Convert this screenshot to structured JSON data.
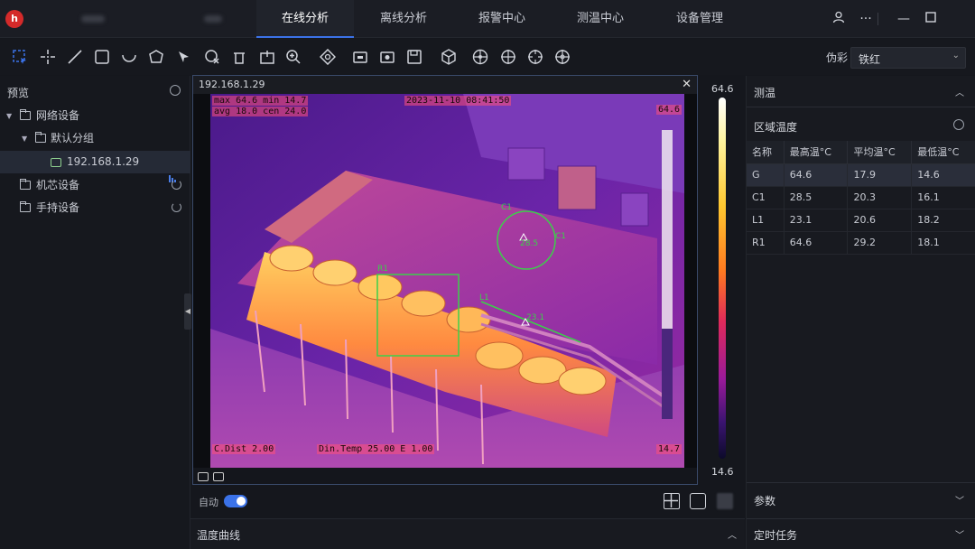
{
  "topbar": {
    "logo": "h",
    "tabs": [
      {
        "label": "在线分析",
        "active": true
      },
      {
        "label": "离线分析",
        "active": false
      },
      {
        "label": "报警中心",
        "active": false
      },
      {
        "label": "测温中心",
        "active": false
      },
      {
        "label": "设备管理",
        "active": false
      }
    ],
    "icons": [
      "user-icon",
      "more-icon",
      "minimize-icon",
      "maximize-icon"
    ]
  },
  "toolbar": {
    "palette_label": "伪彩",
    "palette_value": "铁红"
  },
  "sidebar": {
    "title": "预览",
    "tree": [
      {
        "label": "网络设备",
        "level": 0
      },
      {
        "label": "默认分组",
        "level": 1
      },
      {
        "label": "192.168.1.29",
        "level": 2
      },
      {
        "label": "机芯设备",
        "level": 0
      },
      {
        "label": "手持设备",
        "level": 0
      }
    ]
  },
  "viewer": {
    "title": "192.168.1.29",
    "osd": {
      "max": "max  64.6 min  14.7",
      "avg": "avg  18.0 cen  24.0",
      "datetime": "2023-11-10 08:41:50",
      "top_right": "64.6",
      "bottom_left": "C.Dist 2.00",
      "bottom_mid": "Din.Temp  25.00  E 1.00",
      "bottom_right": "14.7"
    },
    "markers": {
      "c1_label": "C1",
      "c1_value": "28.5",
      "r1_label": "R1",
      "l1_label": "L1",
      "l1_value": "23.1"
    }
  },
  "scale": {
    "max": "64.6",
    "min": "14.6"
  },
  "bottom": {
    "auto_label": "自动",
    "title": "温度曲线"
  },
  "right_panel": {
    "section_title": "测温",
    "subsection_title": "区域温度",
    "table": {
      "headers": [
        "名称",
        "最高温°C",
        "平均温°C",
        "最低温°C"
      ],
      "rows": [
        [
          "G",
          "64.6",
          "17.9",
          "14.6"
        ],
        [
          "C1",
          "28.5",
          "20.3",
          "16.1"
        ],
        [
          "L1",
          "23.1",
          "20.6",
          "18.2"
        ],
        [
          "R1",
          "64.6",
          "29.2",
          "18.1"
        ]
      ]
    },
    "params_title": "参数",
    "timer_title": "定时任务"
  }
}
